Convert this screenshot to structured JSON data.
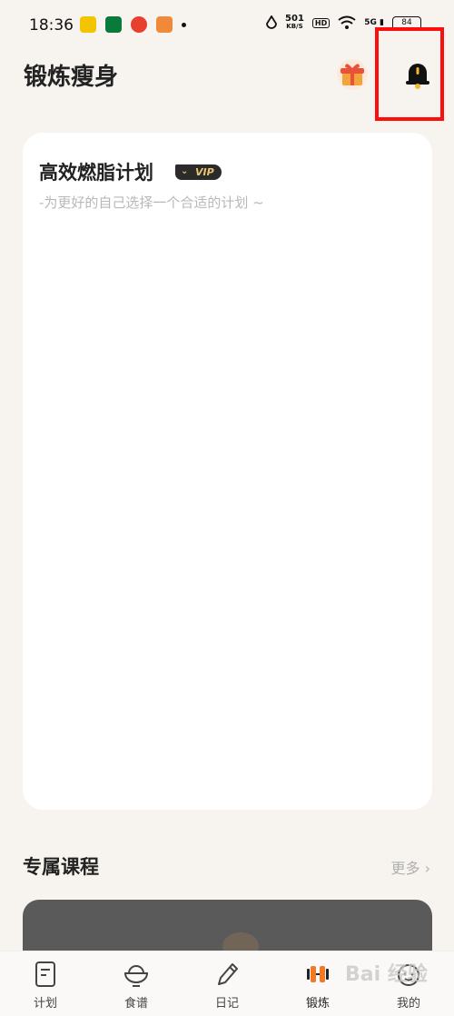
{
  "status_bar": {
    "time": "18:36",
    "speed_value": "501",
    "speed_unit": "KB/S",
    "hd": "HD",
    "network": "5G",
    "battery": "84"
  },
  "header": {
    "title": "锻炼瘦身",
    "gift_icon": "gift-icon",
    "bell_icon": "bell-icon"
  },
  "plan_card": {
    "title": "高效燃脂计划",
    "vip_label": "VIP",
    "subtitle": "-为更好的自己选择一个合适的计划 ~"
  },
  "courses": {
    "title": "专属课程",
    "more_label": "更多 ›"
  },
  "bottom_nav": {
    "items": [
      {
        "label": "计划",
        "icon": "plan-icon"
      },
      {
        "label": "食谱",
        "icon": "recipe-icon"
      },
      {
        "label": "日记",
        "icon": "diary-icon"
      },
      {
        "label": "锻炼",
        "icon": "workout-icon",
        "active": true
      },
      {
        "label": "我的",
        "icon": "profile-icon"
      }
    ]
  },
  "watermark": "Bai 经验",
  "colors": {
    "background": "#f7f3ef",
    "card": "#ffffff",
    "highlight": "#ff0d0d",
    "vip_gold": "#e9c46a",
    "active_orange": "#f07a2a"
  }
}
